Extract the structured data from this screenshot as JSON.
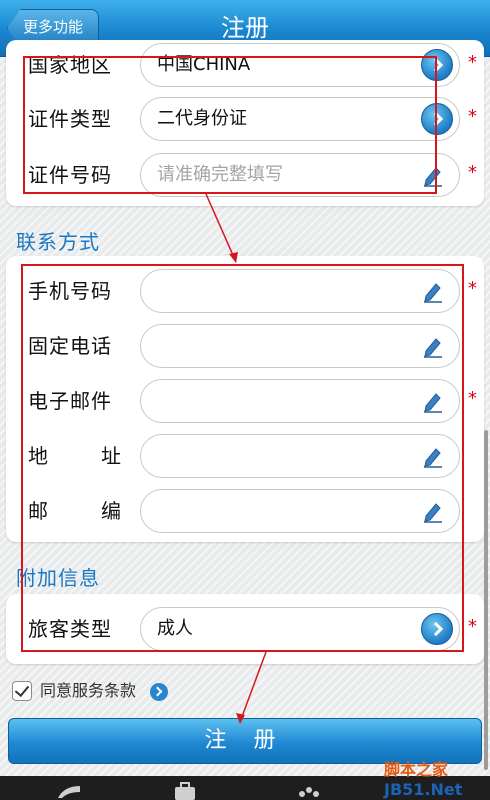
{
  "header": {
    "back_label": "更多功能",
    "title": "注册"
  },
  "identity": [
    {
      "label": "国家地区",
      "value": "中国CHINA",
      "control": "select",
      "required": true
    },
    {
      "label": "证件类型",
      "value": "二代身份证",
      "control": "select",
      "required": true
    },
    {
      "label": "证件号码",
      "placeholder": "请准确完整填写",
      "control": "text",
      "required": true
    }
  ],
  "contact": {
    "title": "联系方式",
    "fields": [
      {
        "label": "手机号码",
        "value": "",
        "required": true
      },
      {
        "label": "固定电话",
        "value": "",
        "required": false
      },
      {
        "label": "电子邮件",
        "value": "",
        "required": true
      },
      {
        "label": "地址",
        "value": "",
        "required": false
      },
      {
        "label": "邮编",
        "value": "",
        "required": false
      }
    ]
  },
  "extra": {
    "title": "附加信息",
    "fields": [
      {
        "label": "旅客类型",
        "value": "成人",
        "control": "select",
        "required": true
      }
    ]
  },
  "agree": {
    "checked": true,
    "label": "同意服务条款"
  },
  "submit_label": "注 册",
  "required_mark": "*",
  "watermark": {
    "part1": "脚本之家",
    "part2": "JB51.Net"
  },
  "colors": {
    "accent": "#1a86cf",
    "required": "#e0001a",
    "annotation": "#d6151f"
  }
}
